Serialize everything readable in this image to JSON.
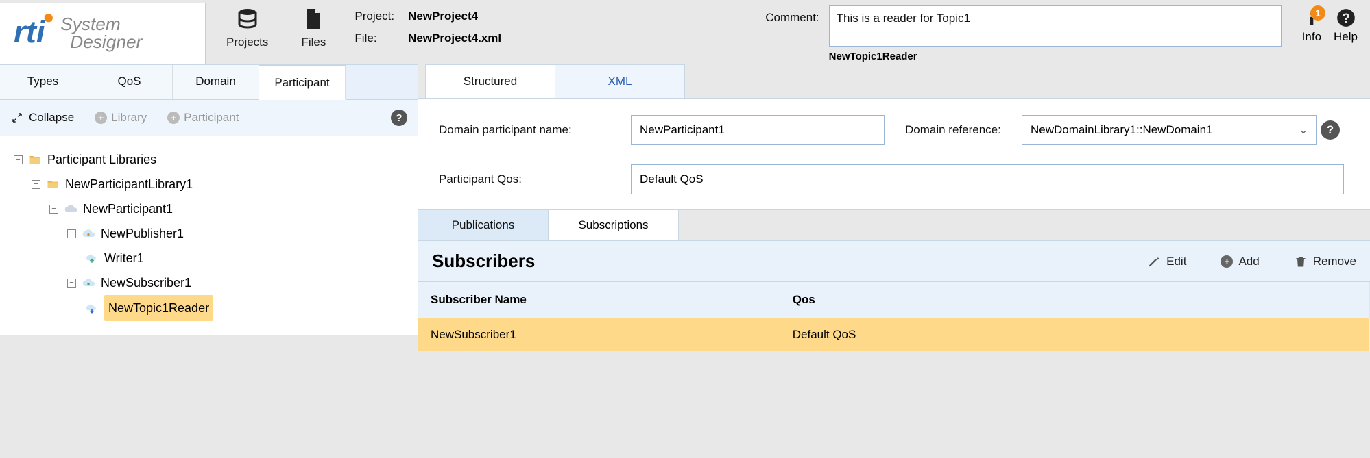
{
  "header": {
    "logo_line1": "System",
    "logo_line2": "Designer",
    "projects_btn": "Projects",
    "files_btn": "Files",
    "project_label": "Project:",
    "project_value": "NewProject4",
    "file_label": "File:",
    "file_value": "NewProject4.xml",
    "comment_label": "Comment:",
    "comment_value": "This is a reader for Topic1",
    "comment_caption": "NewTopic1Reader",
    "info_label": "Info",
    "info_badge": "1",
    "help_label": "Help"
  },
  "tabs_top": [
    "Types",
    "QoS",
    "Domain",
    "Participant"
  ],
  "tabs_top_active": 3,
  "side_toolbar": {
    "collapse": "Collapse",
    "library": "Library",
    "participant": "Participant"
  },
  "tree": {
    "root": "Participant Libraries",
    "lib": "NewParticipantLibrary1",
    "participant": "NewParticipant1",
    "publisher": "NewPublisher1",
    "writer": "Writer1",
    "subscriber": "NewSubscriber1",
    "reader": "NewTopic1Reader"
  },
  "right_tabs": {
    "structured": "Structured",
    "xml": "XML"
  },
  "form": {
    "dp_name_label": "Domain participant name:",
    "dp_name_value": "NewParticipant1",
    "dr_label": "Domain reference:",
    "dr_value": "NewDomainLibrary1::NewDomain1",
    "pqos_label": "Participant Qos:",
    "pqos_value": "Default QoS"
  },
  "pubsub": {
    "publications": "Publications",
    "subscriptions": "Subscriptions"
  },
  "section": {
    "title": "Subscribers",
    "edit": "Edit",
    "add": "Add",
    "remove": "Remove",
    "col_name": "Subscriber Name",
    "col_qos": "Qos",
    "row_name": "NewSubscriber1",
    "row_qos": "Default QoS"
  }
}
